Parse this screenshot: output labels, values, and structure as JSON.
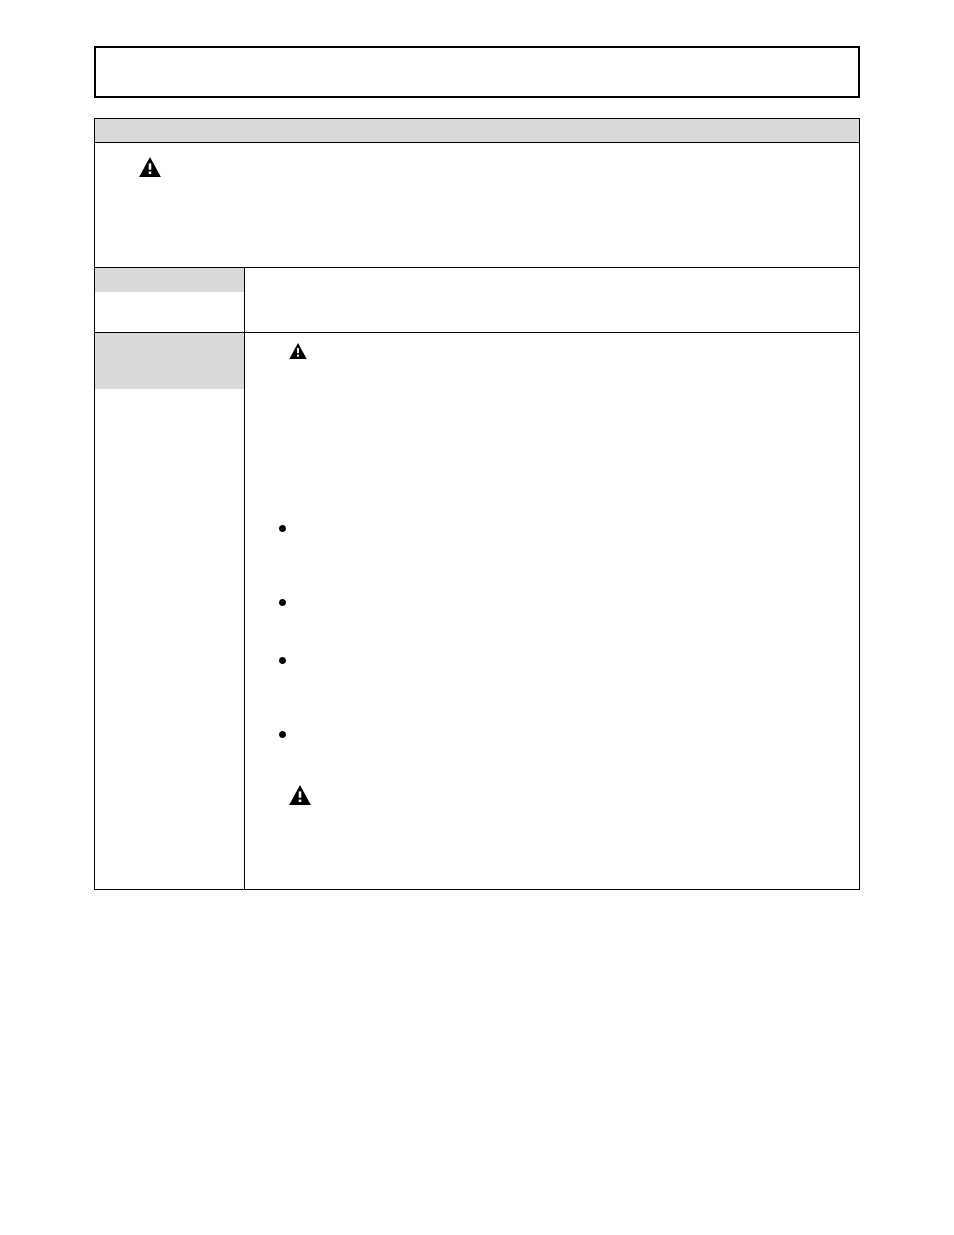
{
  "title_box": "",
  "section_header": "",
  "warning_top": {
    "icon": "warning-triangle-icon",
    "text": ""
  },
  "mid_row": {
    "left_label": "",
    "right_text": ""
  },
  "body_row": {
    "left_label": "",
    "warning_a": {
      "icon": "warning-triangle-icon",
      "text": ""
    },
    "paragraph": "",
    "bullets": [
      "",
      "",
      "",
      ""
    ],
    "warning_b": {
      "icon": "warning-triangle-icon",
      "text": ""
    }
  }
}
